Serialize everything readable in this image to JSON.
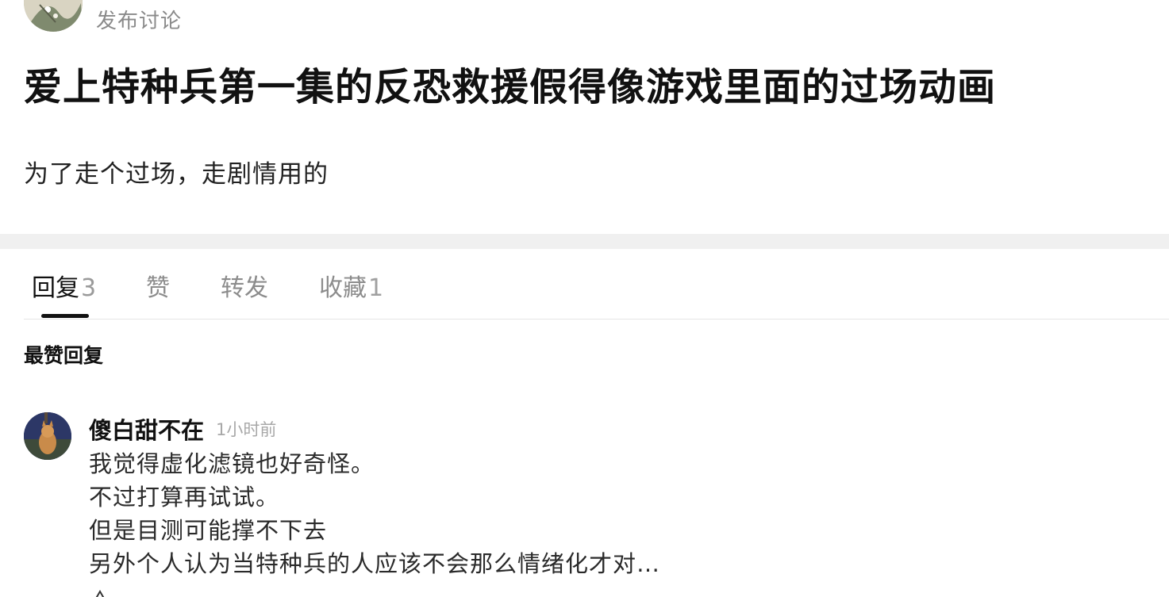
{
  "post": {
    "action": "发布讨论",
    "title": "爱上特种兵第一集的反恐救援假得像游戏里面的过场动画",
    "body": "为了走个过场，走剧情用的"
  },
  "tabs": [
    {
      "label": "回复",
      "count": "3",
      "active": true
    },
    {
      "label": "赞",
      "count": "",
      "active": false
    },
    {
      "label": "转发",
      "count": "",
      "active": false
    },
    {
      "label": "收藏",
      "count": "1",
      "active": false
    }
  ],
  "section_label": "最赞回复",
  "reply": {
    "user": "傻白甜不在",
    "time": "1小时前",
    "lines": [
      "我觉得虚化滤镜也好奇怪。",
      "不过打算再试试。",
      "但是目测可能撑不下去",
      "另外个人认为当特种兵的人应该不会那么情绪化才对…"
    ]
  },
  "colors": {
    "title": "#111111",
    "muted": "#8c8c8c",
    "divider_band": "#f0f0f0",
    "indicator": "#111111"
  }
}
